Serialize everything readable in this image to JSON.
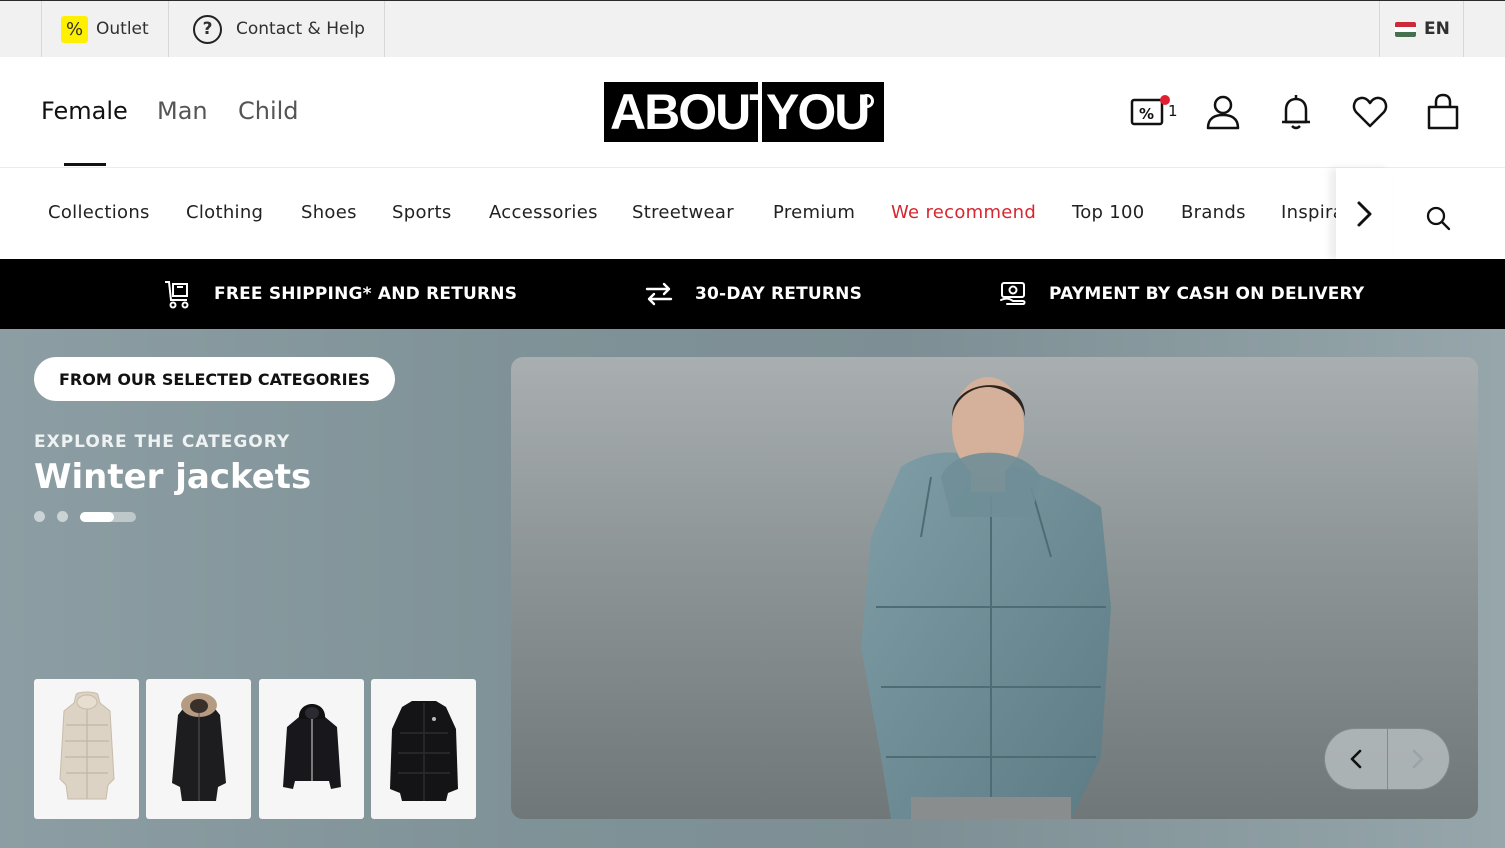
{
  "topbar": {
    "outlet": {
      "label": "Outlet",
      "icon": "percent-icon"
    },
    "help": {
      "label": "Contact & Help",
      "icon": "question-circle-icon"
    },
    "language": {
      "label": "EN",
      "icon": "hungary-flag-icon"
    }
  },
  "header": {
    "genders": [
      "Female",
      "Man",
      "Child"
    ],
    "active_gender": "Female",
    "logo": {
      "part1": "ABOUT",
      "part2": "YOU"
    },
    "icons": {
      "deals_badge": "1",
      "names": [
        "discount-tag-icon",
        "user-icon",
        "bell-icon",
        "heart-icon",
        "shopping-bag-icon"
      ]
    }
  },
  "categories": {
    "items": [
      "Collections",
      "Clothing",
      "Shoes",
      "Sports",
      "Accessories",
      "Streetwear",
      "Premium",
      "We recommend",
      "Top 100",
      "Brands",
      "Inspiration"
    ],
    "highlight": "We recommend",
    "highlight_color": "#d6262f"
  },
  "promo": {
    "items": [
      {
        "label": "FREE SHIPPING* AND RETURNS",
        "icon": "cart-icon"
      },
      {
        "label": "30-DAY RETURNS",
        "icon": "arrows-exchange-icon"
      },
      {
        "label": "PAYMENT BY CASH ON DELIVERY",
        "icon": "cash-hand-icon"
      }
    ]
  },
  "hero": {
    "pill": "FROM OUR SELECTED CATEGORIES",
    "eyebrow": "EXPLORE THE CATEGORY",
    "title": "Winter jackets",
    "slides_total": 3,
    "slide_active": 3,
    "thumbnails": [
      "beige-puffer-coat",
      "black-parka-fur-hood",
      "black-hooded-jacket",
      "black-puffer-jacket"
    ],
    "main_image": "woman-in-teal-puffer-jacket"
  }
}
